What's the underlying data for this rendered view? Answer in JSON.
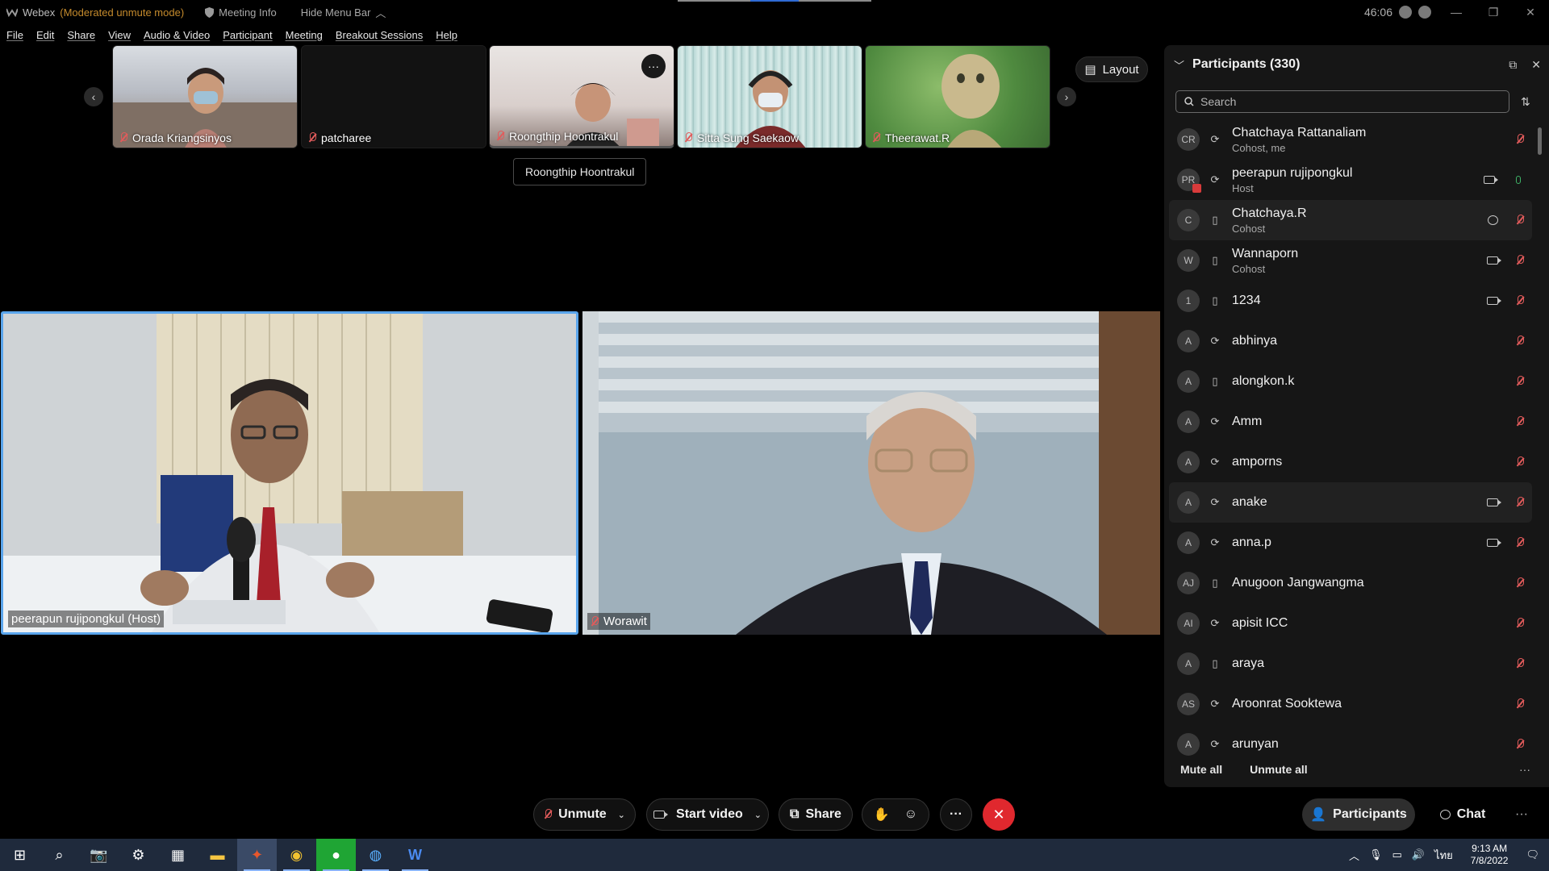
{
  "window": {
    "app_name": "Webex",
    "mode": "(Moderated unmute mode)",
    "meeting_info": "Meeting Info",
    "hide_menu": "Hide Menu Bar",
    "timer": "46:06"
  },
  "menu": [
    "File",
    "Edit",
    "Share",
    "View",
    "Audio & Video",
    "Participant",
    "Meeting",
    "Breakout Sessions",
    "Help"
  ],
  "thumbnails": [
    {
      "name": "Orada Kriangsinyos"
    },
    {
      "name": "patcharee"
    },
    {
      "name": "Roongthip Hoontrakul"
    },
    {
      "name": "Sitta Sung Saekaow"
    },
    {
      "name": "Theerawat.R"
    }
  ],
  "tooltip": "Roongthip Hoontrakul",
  "layout_label": "Layout",
  "main_videos": [
    {
      "name": "peerapun rujipongkul (Host)"
    },
    {
      "name": "Worawit"
    }
  ],
  "panel": {
    "title": "Participants (330)",
    "search_placeholder": "Search",
    "mute_all": "Mute all",
    "unmute_all": "Unmute all"
  },
  "participants": [
    {
      "initials": "CR",
      "name": "Chatchaya Rattanaliam",
      "role": "Cohost, me"
    },
    {
      "initials": "PR",
      "name": "peerapun rujipongkul",
      "role": "Host"
    },
    {
      "initials": "C",
      "name": "Chatchaya.R",
      "role": "Cohost"
    },
    {
      "initials": "W",
      "name": "Wannaporn",
      "role": "Cohost"
    },
    {
      "initials": "1",
      "name": "1234",
      "role": ""
    },
    {
      "initials": "A",
      "name": "abhinya",
      "role": ""
    },
    {
      "initials": "A",
      "name": "alongkon.k",
      "role": ""
    },
    {
      "initials": "A",
      "name": "Amm",
      "role": ""
    },
    {
      "initials": "A",
      "name": "amporns",
      "role": ""
    },
    {
      "initials": "A",
      "name": "anake",
      "role": ""
    },
    {
      "initials": "A",
      "name": "anna.p",
      "role": ""
    },
    {
      "initials": "AJ",
      "name": "Anugoon Jangwangma",
      "role": ""
    },
    {
      "initials": "AI",
      "name": "apisit ICC",
      "role": ""
    },
    {
      "initials": "A",
      "name": "araya",
      "role": ""
    },
    {
      "initials": "AS",
      "name": "Aroonrat Sooktewa",
      "role": ""
    },
    {
      "initials": "A",
      "name": "arunyan",
      "role": ""
    }
  ],
  "controls": {
    "unmute": "Unmute",
    "start_video": "Start video",
    "share": "Share",
    "participants_tab": "Participants",
    "chat_tab": "Chat"
  },
  "taskbar": {
    "time": "9:13 AM",
    "date": "7/8/2022",
    "lang": "ไทย"
  },
  "colors": {
    "end_call": "#e0282e",
    "active_speaker_border": "#5aa5ec",
    "muted_icon": "#e25b5b",
    "moderated_mode_text": "#c48a2c"
  }
}
